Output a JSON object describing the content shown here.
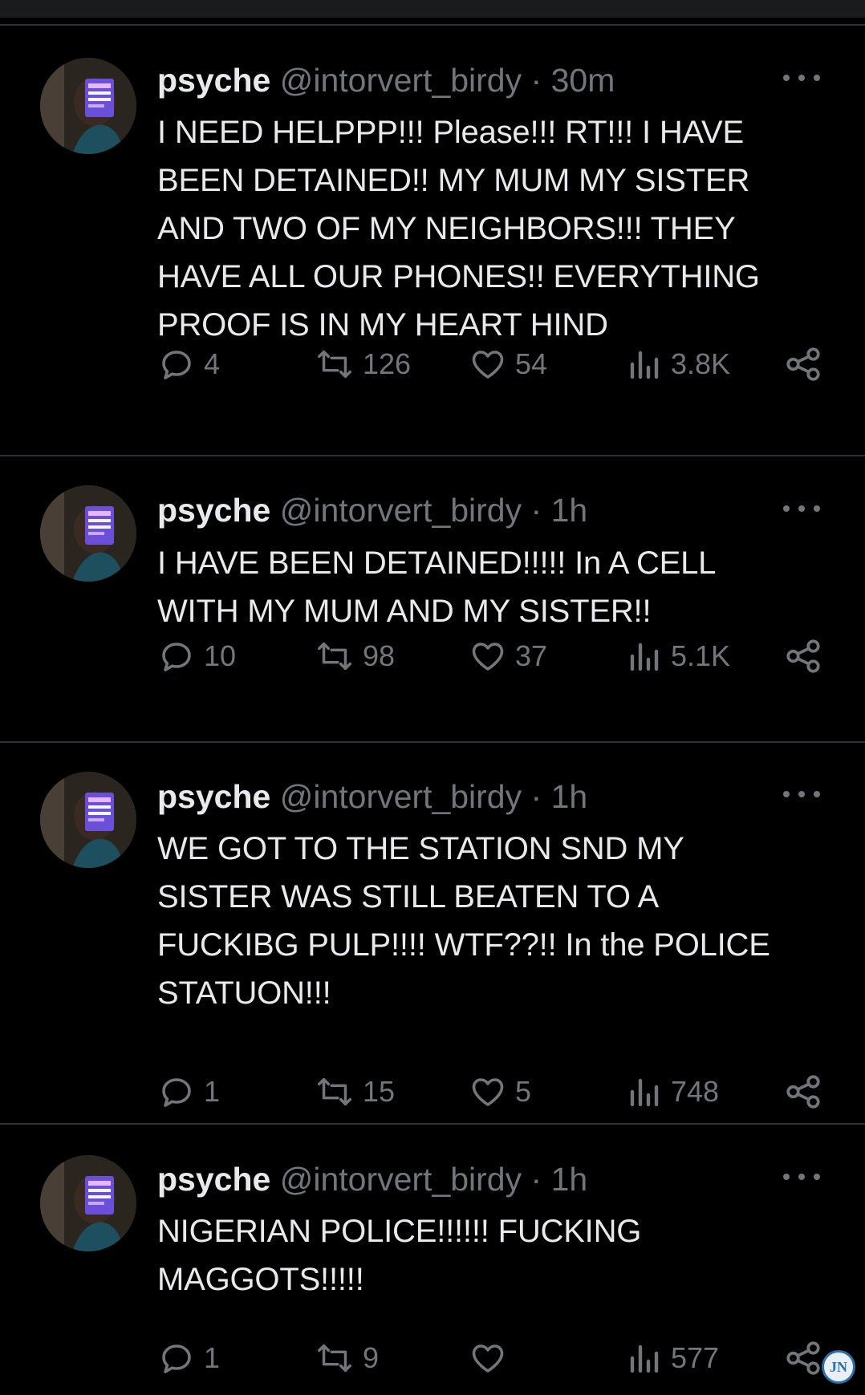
{
  "colors": {
    "background": "#000000",
    "text": "#e7e9ea",
    "muted": "#71767b",
    "separator": "#2f3336"
  },
  "tweets": [
    {
      "name": "psyche",
      "handle": "@intorvert_birdy",
      "separator": "·",
      "time": "30m",
      "text": "I NEED HELPPP!!! Please!!! RT!!! I HAVE\nBEEN DETAINED!!  MY MUM MY SISTER\nAND TWO OF MY NEIGHBORS!!! THEY\nHAVE ALL OUR  PHONES!! EVERYTHING\nPROOF IS IN MY HEART HIND",
      "replies": "4",
      "reposts": "126",
      "likes": "54",
      "views": "3.8K",
      "icons": [
        "reply-icon",
        "repost-icon",
        "like-icon",
        "views-icon",
        "share-icon"
      ]
    },
    {
      "name": "psyche",
      "handle": "@intorvert_birdy",
      "separator": "·",
      "time": "1h",
      "text": "I HAVE BEEN DETAINED!!!!! In A CELL\nWITH MY MUM AND MY SISTER!!",
      "replies": "10",
      "reposts": "98",
      "likes": "37",
      "views": "5.1K",
      "icons": [
        "reply-icon",
        "repost-icon",
        "like-icon",
        "views-icon",
        "share-icon"
      ]
    },
    {
      "name": "psyche",
      "handle": "@intorvert_birdy",
      "separator": "·",
      "time": "1h",
      "text": "WE GOT TO THE STATION SND MY\nSISTER WAS STILL BEATEN TO A\nFUCKIBG PULP!!!! WTF??!! In the POLICE\nSTATUON!!!",
      "replies": "1",
      "reposts": "15",
      "likes": "5",
      "views": "748",
      "icons": [
        "reply-icon",
        "repost-icon",
        "like-icon",
        "views-icon",
        "share-icon"
      ]
    },
    {
      "name": "psyche",
      "handle": "@intorvert_birdy",
      "separator": "·",
      "time": "1h",
      "text": "NIGERIAN POLICE!!!!!! FUCKING\nMAGGOTS!!!!!",
      "replies": "1",
      "reposts": "9",
      "likes": "",
      "views": "577",
      "icons": [
        "reply-icon",
        "repost-icon",
        "like-icon",
        "views-icon",
        "share-icon"
      ]
    }
  ],
  "watermark": {
    "text": "JN",
    "icon": "watermark-logo"
  }
}
